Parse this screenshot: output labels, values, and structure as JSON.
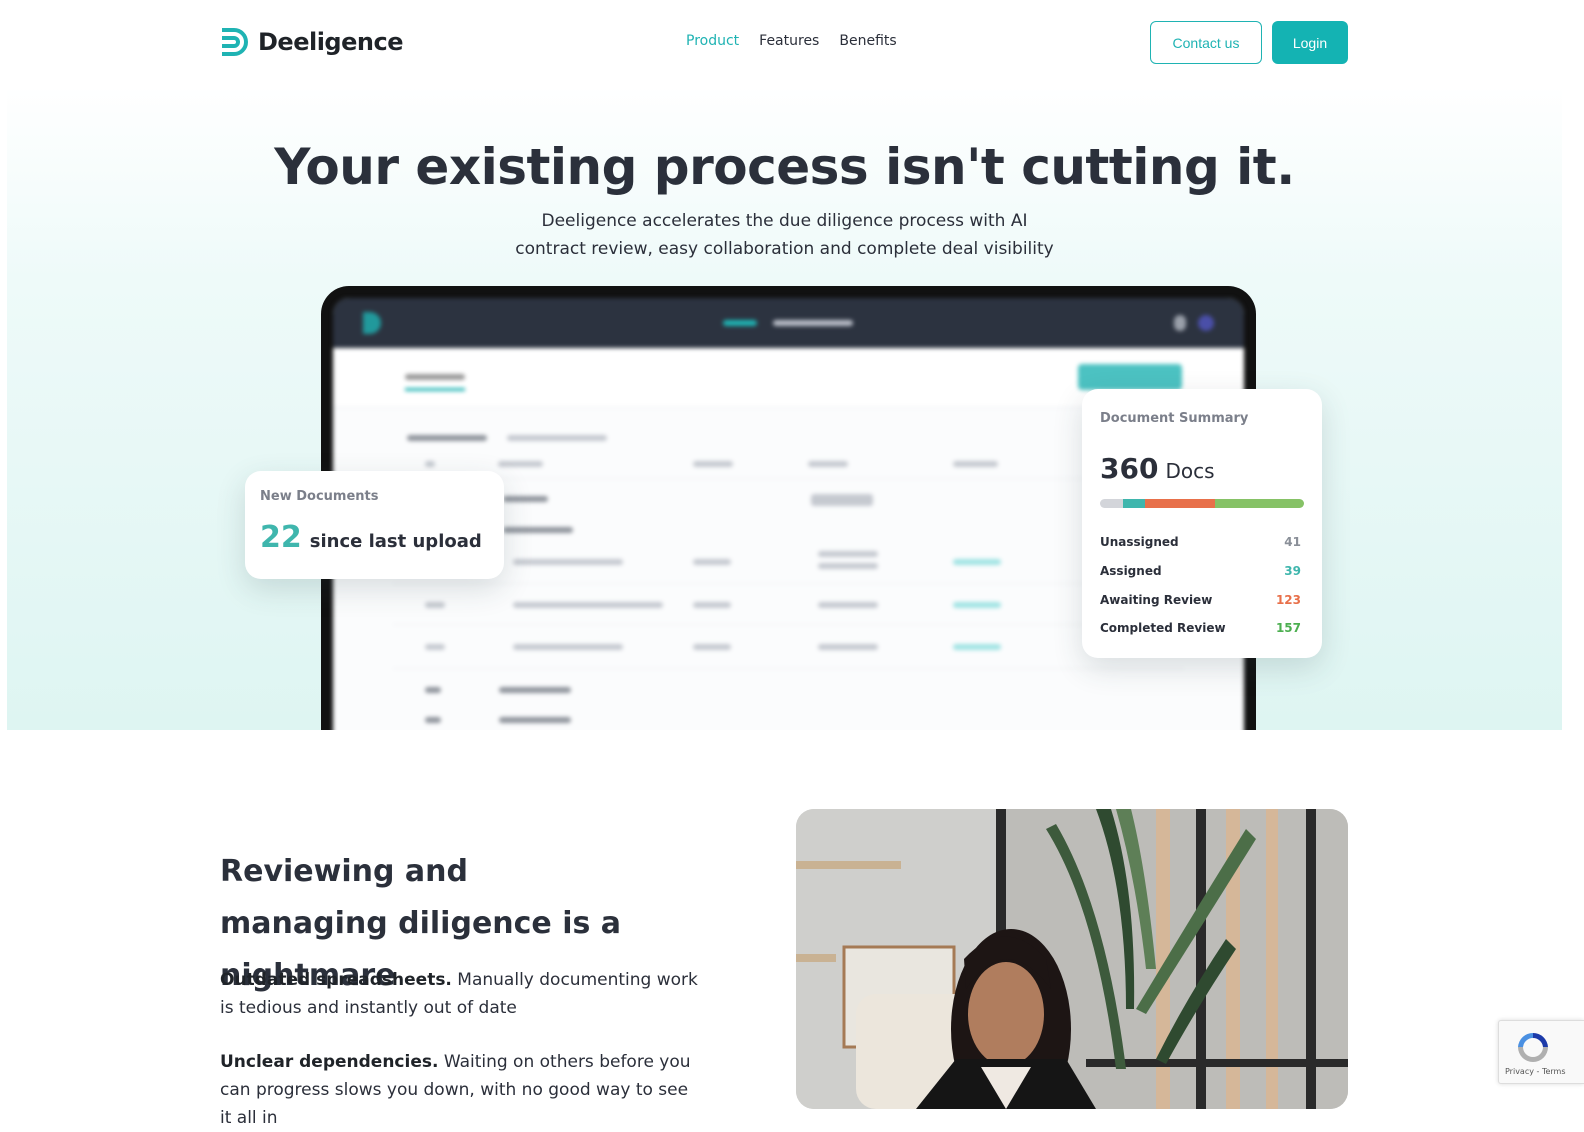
{
  "header": {
    "brand": "Deeligence",
    "nav": [
      {
        "label": "Product",
        "active": true
      },
      {
        "label": "Features",
        "active": false
      },
      {
        "label": "Benefits",
        "active": false
      }
    ],
    "contact_label": "Contact us",
    "login_label": "Login",
    "accent_color": "#14b3b3"
  },
  "hero": {
    "title": "Your existing process isn't cutting it.",
    "subtitle_line1": "Deeligence accelerates the due diligence process with AI",
    "subtitle_line2": "contract review, easy collaboration and complete deal visibility"
  },
  "new_documents_card": {
    "label": "New Documents",
    "count": "22",
    "text": "since last upload"
  },
  "document_summary_card": {
    "label": "Document Summary",
    "total": "360",
    "unit": "Docs",
    "stats": [
      {
        "label": "Unassigned",
        "value": 41,
        "color": "#8a8f98",
        "bar_color": "#d3d5da"
      },
      {
        "label": "Assigned",
        "value": 39,
        "color": "#3fb6ad",
        "bar_color": "#3fb6ad"
      },
      {
        "label": "Awaiting Review",
        "value": 123,
        "color": "#e8704a",
        "bar_color": "#e8704a"
      },
      {
        "label": "Completed Review",
        "value": 157,
        "color": "#4caf50",
        "bar_color": "#86c266"
      }
    ]
  },
  "section": {
    "title": "Reviewing and managing diligence is a nightmare",
    "points": [
      {
        "bold": "Outdated spreadsheets.",
        "text": " Manually documenting work is tedious and instantly out of date"
      },
      {
        "bold": "Unclear dependencies.",
        "text": " Waiting on others before you can progress slows you down, with no good way to see it all in"
      }
    ]
  },
  "recaptcha": {
    "links": "Privacy - Terms"
  }
}
